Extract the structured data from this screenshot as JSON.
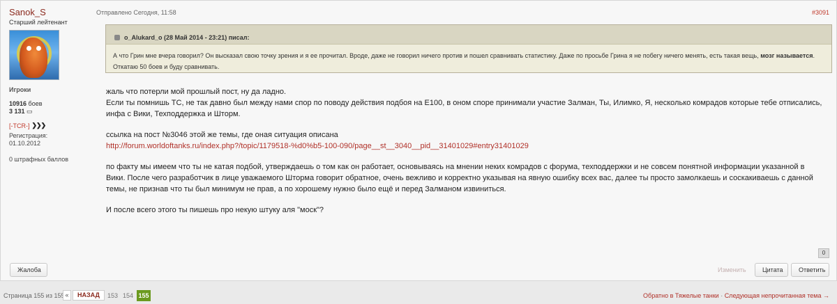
{
  "author": {
    "name": "Sanok_S",
    "rank": "Старший лейтенант",
    "group": "Игроки",
    "battles_value": "10916",
    "battles_label": "боев",
    "medals_value": "3 131",
    "clan": "[-TCR-]",
    "reg_label": "Регистрация:",
    "reg_date": "01.10.2012",
    "warnings": "0 штрафных баллов"
  },
  "post": {
    "posted": "Отправлено Сегодня, 11:58",
    "number": "#3091",
    "reputation": "0"
  },
  "quote": {
    "header": "o_Alukard_o (28 Май 2014 - 23:21) писал:",
    "body_main": "А что Грин мне вчера говорил? Он высказал свою точку зрения и я ее прочитал. Вроде, даже не говорил ничего против и пошел сравнивать статистику. Даже по просьбе Грина я не побегу ничего менять, есть такая вещь, ",
    "body_bold": "мозг называется",
    "body_end": ".",
    "body_line2": "Откатаю 50 боев и буду сравнивать."
  },
  "content": {
    "p1": "жаль что потерли мой прошлый пост, ну да ладно.",
    "p2": "Если ты помнишь ТС, не так давно был между нами спор по поводу действия подбоя на Е100, в оном споре принимали участие Залман, Ты, Илимко, Я, несколько комрадов которые тебе отписались, инфа с Вики, Техподдержка и Шторм.",
    "p3": "ссылка на пост №3046 этой же темы, где оная ситуация описана",
    "link": "http://forum.worldoftanks.ru/index.php?/topic/1179518-%d0%b5-100-090/page__st__3040__pid__31401029#entry31401029",
    "p4": "по факту мы имеем что ты не катая подбой, утверждаешь о том как он работает, основываясь на мнении неких комрадов с форума, техподдержки и не совсем понятной информации указанной в Вики. После чего разработчик в лице уважаемого Шторма говорит обратное, очень вежливо и корректно указывая на явную ошибку всех вас, далее ты просто замолкаешь и соскакиваешь с данной темы, не признав что ты был минимум не прав, а по хорошему нужно было ещё и перед Залманом извиниться.",
    "p5": "И после всего этого ты пишешь про некую штуку аля \"моск\"?"
  },
  "actions": {
    "report": "Жалоба",
    "edit": "Изменить",
    "quote": "Цитата",
    "reply": "Ответить"
  },
  "pager": {
    "label": "Страница 155 из 155",
    "prev": "«",
    "back": "НАЗАД",
    "p153": "153",
    "p154": "154",
    "p155": "155",
    "back_to": "Обратно в Тяжелые танки",
    "sep": " · ",
    "next_unread": "Следующая непрочитанная тема",
    "arrow": "→"
  }
}
